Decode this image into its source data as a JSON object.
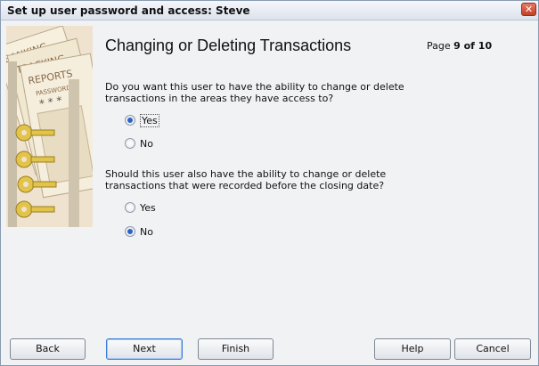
{
  "window": {
    "title": "Set up user password and access: Steve",
    "close_glyph": "✕"
  },
  "art": {
    "words": [
      "BANKING",
      "TRACKING",
      "REPORTS",
      "PASSWORD",
      "* * *"
    ]
  },
  "header": {
    "heading": "Changing or Deleting Transactions",
    "page_prefix": "Page",
    "page_current": "9 of 10"
  },
  "question1": {
    "text": "Do you want this user to have the ability to change or delete transactions in the areas they have access to?",
    "options": [
      {
        "label": "Yes",
        "selected": true
      },
      {
        "label": "No",
        "selected": false
      }
    ]
  },
  "question2": {
    "text": "Should this user also have the ability to change or delete transactions that were recorded before the closing date?",
    "options": [
      {
        "label": "Yes",
        "selected": false
      },
      {
        "label": "No",
        "selected": true
      }
    ]
  },
  "buttons": {
    "back": "Back",
    "next": "Next",
    "finish": "Finish",
    "help": "Help",
    "cancel": "Cancel"
  }
}
